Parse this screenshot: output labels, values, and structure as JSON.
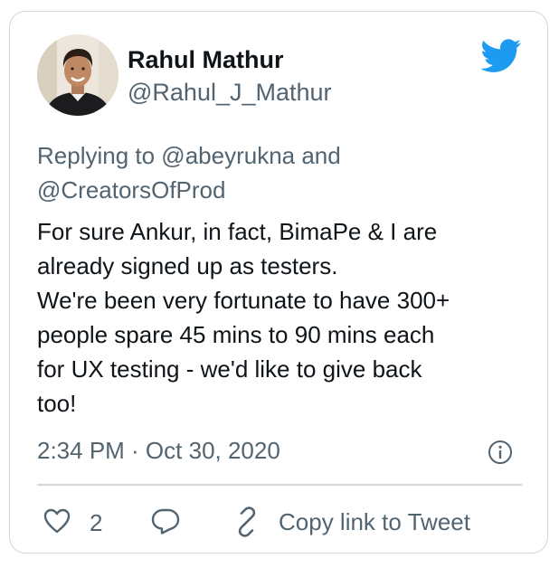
{
  "tweet": {
    "author_name": "Rahul Mathur",
    "author_handle": "@Rahul_J_Mathur",
    "replying_to": [
      "Replying to @abeyrukna and",
      "@CreatorsOfProd"
    ],
    "body_lines": [
      "For sure Ankur, in fact, BimaPe & I are",
      "already signed up as testers.",
      "We're been very fortunate to have 300+",
      "people spare 45 mins to 90 mins each",
      "for UX testing - we'd like to give back",
      "too!"
    ],
    "timestamp": "2:34 PM · Oct 30, 2020"
  },
  "actions": {
    "like_count": "2",
    "copy_link_label": "Copy link to Tweet"
  },
  "colors": {
    "twitter_blue": "#1d9bf0",
    "secondary_text": "#536471",
    "primary_text": "#0f1419",
    "border": "#cfd9de"
  },
  "icons": {
    "brand": "twitter-bird-icon",
    "info": "info-icon",
    "like": "heart-icon",
    "reply": "reply-icon",
    "link": "link-icon"
  }
}
